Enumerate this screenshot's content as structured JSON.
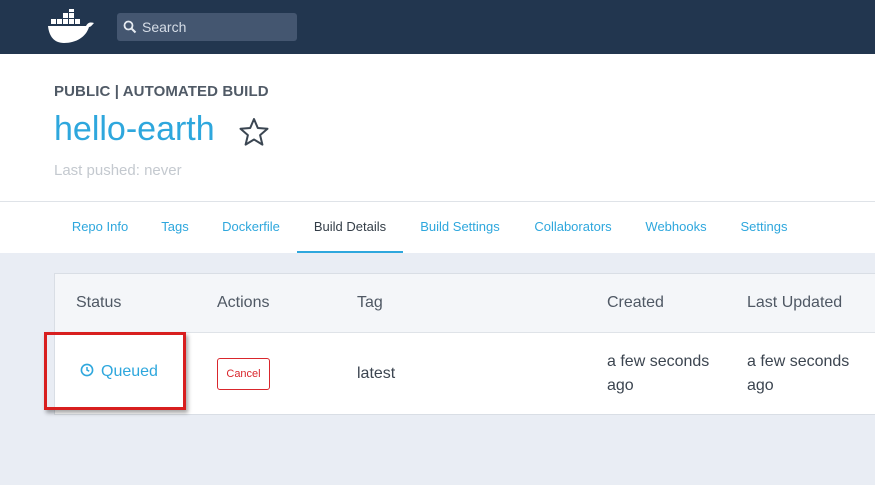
{
  "topbar": {
    "logo_icon": "docker-whale-icon",
    "search_placeholder": "Search"
  },
  "repo": {
    "type_label": "PUBLIC | AUTOMATED BUILD",
    "name": "hello-earth",
    "star_icon": "star-icon",
    "last_pushed": "Last pushed: never"
  },
  "tabs": [
    {
      "label": "Repo Info"
    },
    {
      "label": "Tags"
    },
    {
      "label": "Dockerfile"
    },
    {
      "label": "Build Details",
      "active": true
    },
    {
      "label": "Build Settings"
    },
    {
      "label": "Collaborators"
    },
    {
      "label": "Webhooks"
    },
    {
      "label": "Settings"
    }
  ],
  "builds": {
    "columns": [
      "Status",
      "Actions",
      "Tag",
      "Created",
      "Last Updated"
    ],
    "rows": [
      {
        "status": "Queued",
        "status_icon": "clock-icon",
        "action": "Cancel",
        "tag": "latest",
        "created_line1": "a few seconds",
        "created_line2": "ago",
        "updated_line1": "a few seconds",
        "updated_line2": "ago"
      }
    ]
  },
  "colors": {
    "topbar": "#22364f",
    "accent": "#2ea7dd",
    "cancel": "#d9262c",
    "highlight": "#d81f1f",
    "background": "#e9edf4"
  }
}
